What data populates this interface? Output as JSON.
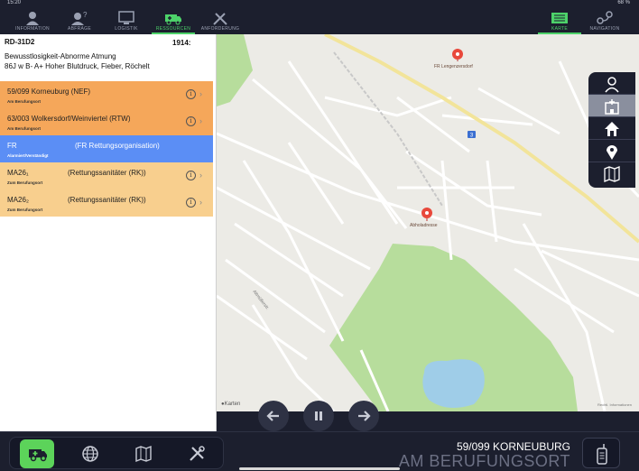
{
  "status_bar": {
    "time": "15:20",
    "right": "68 %"
  },
  "top_nav": {
    "left": [
      {
        "label": "INFORMATION",
        "icon": "person-info-icon"
      },
      {
        "label": "ABFRAGE",
        "icon": "person-question-icon"
      },
      {
        "label": "LOGISTIK",
        "icon": "monitor-icon"
      },
      {
        "label": "RESSOURCEN",
        "icon": "ambulance-icon"
      },
      {
        "label": "ANFORDERUNG",
        "icon": "tools-icon"
      }
    ],
    "right": [
      {
        "label": "KARTE",
        "icon": "map-icon"
      },
      {
        "label": "NAVIGATION",
        "icon": "route-icon"
      }
    ],
    "active_color": "#4dd26a"
  },
  "incident": {
    "code": "RD-31D2",
    "time": "1914:",
    "line1": "Bewusstlosigkeit-Abnorme Atmung",
    "line2": "86J w B- A+ Hoher Blutdruck, Fieber, Röchelt"
  },
  "units": [
    {
      "name": "59/099 Korneuburg (NEF)",
      "desc": "",
      "status": "Am Berufungsort",
      "color": "#f5a75a"
    },
    {
      "name": "63/003 Wolkersdorf/Weinviertel (RTW)",
      "desc": "",
      "status": "Am Berufungsort",
      "color": "#f5a75a"
    },
    {
      "name": "FR",
      "desc": "(FR Rettungsorganisation)",
      "status": "Alarmiert/Verständigt",
      "color": "#5b8ef5"
    },
    {
      "name": "MA26₁",
      "desc": "(Rettungssanitäter (RK))",
      "status": "Zum Berufungsort",
      "color": "#f8cf8e"
    },
    {
      "name": "MA26₂",
      "desc": "(Rettungssanitäter (RK))",
      "status": "Zum Berufungsort",
      "color": "#f8cf8e"
    }
  ],
  "map": {
    "pins": [
      {
        "label": "FR Lengenzersdorf"
      },
      {
        "label": "Abholadresse"
      }
    ],
    "route_badge": "3",
    "street_label": "Altmüllerstr.",
    "credit": "Karten",
    "legal": "Rechtl. Informationen",
    "pin_color": "#e8483b",
    "park_color": "#b7dd9c",
    "water_color": "#9fcde8"
  },
  "map_tools": [
    {
      "icon": "person-icon"
    },
    {
      "icon": "hospital-icon"
    },
    {
      "icon": "home-icon"
    },
    {
      "icon": "location-pin-icon"
    },
    {
      "icon": "map-question-icon"
    }
  ],
  "playback": {
    "buttons": [
      "back-arrow-icon",
      "pause-icon",
      "forward-arrow-icon"
    ]
  },
  "bottom": {
    "tools": [
      "ambulance-icon",
      "globe-icon",
      "map-icon",
      "tools-icon"
    ],
    "unit_name": "59/099 KORNEUBURG",
    "unit_status": "AM BERUFUNGSORT",
    "accent": "#5cd35a"
  }
}
